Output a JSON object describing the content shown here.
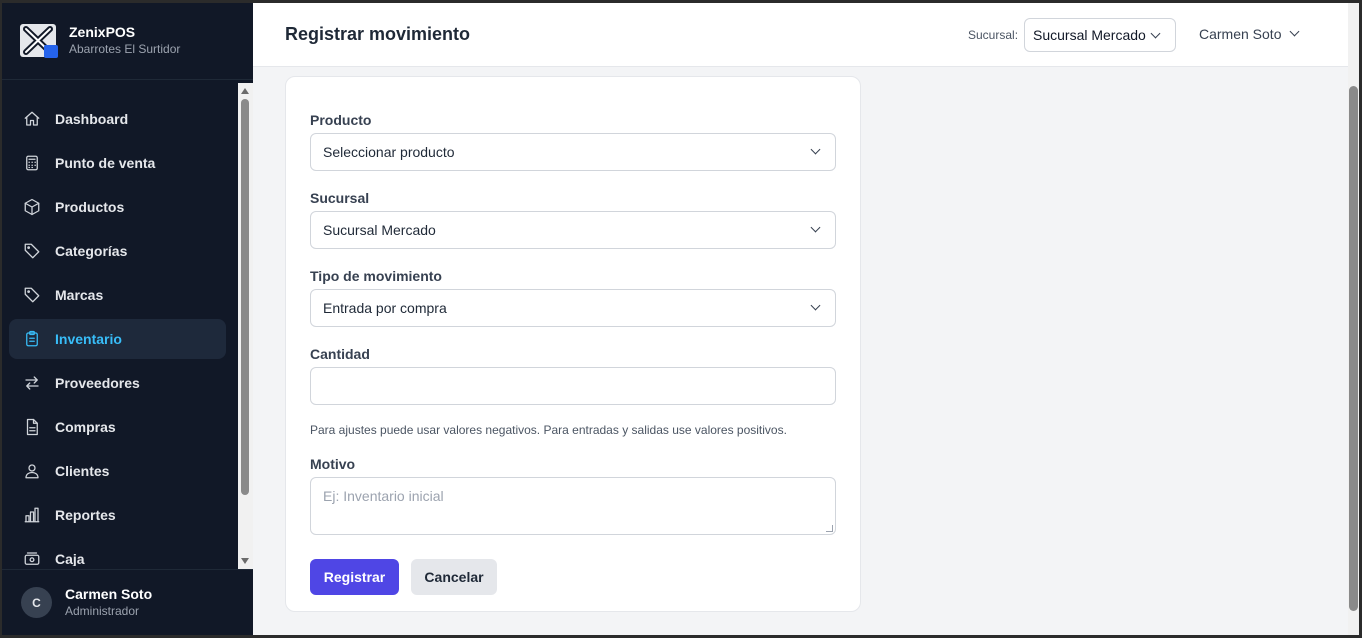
{
  "app": {
    "name": "ZenixPOS",
    "store": "Abarrotes El Surtidor"
  },
  "sidebar": {
    "items": [
      {
        "label": "Dashboard",
        "icon": "home-icon",
        "active": false
      },
      {
        "label": "Punto de venta",
        "icon": "calculator-icon",
        "active": false
      },
      {
        "label": "Productos",
        "icon": "box-icon",
        "active": false
      },
      {
        "label": "Categorías",
        "icon": "tag-icon",
        "active": false
      },
      {
        "label": "Marcas",
        "icon": "tag-icon",
        "active": false
      },
      {
        "label": "Inventario",
        "icon": "clipboard-icon",
        "active": true
      },
      {
        "label": "Proveedores",
        "icon": "arrows-swap-icon",
        "active": false
      },
      {
        "label": "Compras",
        "icon": "document-icon",
        "active": false
      },
      {
        "label": "Clientes",
        "icon": "user-icon",
        "active": false
      },
      {
        "label": "Reportes",
        "icon": "bar-chart-icon",
        "active": false
      },
      {
        "label": "Caja",
        "icon": "cash-icon",
        "active": false
      }
    ],
    "user": {
      "initial": "C",
      "name": "Carmen Soto",
      "role": "Administrador"
    }
  },
  "header": {
    "title": "Registrar movimiento",
    "branch_label": "Sucursal:",
    "branch_value": "Sucursal Mercado",
    "user_name": "Carmen Soto"
  },
  "form": {
    "producto": {
      "label": "Producto",
      "value": "Seleccionar producto"
    },
    "sucursal": {
      "label": "Sucursal",
      "value": "Sucursal Mercado"
    },
    "tipo": {
      "label": "Tipo de movimiento",
      "value": "Entrada por compra"
    },
    "cantidad": {
      "label": "Cantidad",
      "value": ""
    },
    "help": "Para ajustes puede usar valores negativos. Para entradas y salidas use valores positivos.",
    "motivo": {
      "label": "Motivo",
      "placeholder": "Ej: Inventario inicial"
    },
    "submit": "Registrar",
    "cancel": "Cancelar"
  },
  "colors": {
    "sidebar_bg": "#111827",
    "accent": "#38bdf8",
    "primary_button": "#4f46e5"
  }
}
